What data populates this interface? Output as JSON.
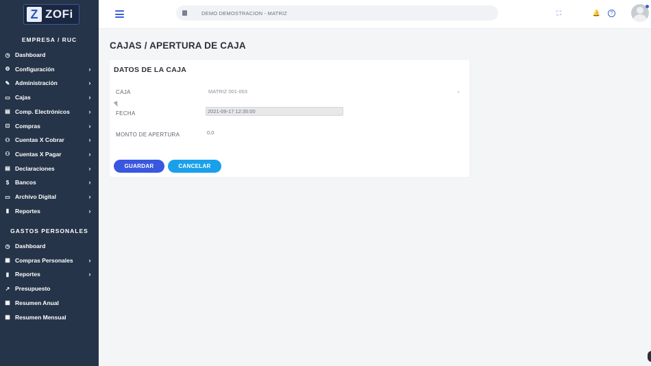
{
  "brand": {
    "logo_letter": "Z",
    "logo_text": "ZOFi"
  },
  "sidebar": {
    "section1_title": "EMPRESA / RUC",
    "items": [
      {
        "label": "Dashboard",
        "icon": "dashboard-icon",
        "glyph": "◷",
        "chevron": ""
      },
      {
        "label": "Configuración",
        "icon": "gear-icon",
        "glyph": "⚙",
        "chevron": "›"
      },
      {
        "label": "Administración",
        "icon": "pencil-icon",
        "glyph": "✎",
        "chevron": "›"
      },
      {
        "label": "Cajas",
        "icon": "cash-box-icon",
        "glyph": "▭",
        "chevron": "›"
      },
      {
        "label": "Comp. Electrónicos",
        "icon": "receipt-icon",
        "glyph": "▤",
        "chevron": "›"
      },
      {
        "label": "Compras",
        "icon": "cart-icon",
        "glyph": "⊡",
        "chevron": "›"
      },
      {
        "label": "Cuentas X Cobrar",
        "icon": "user-receive-icon",
        "glyph": "⚇",
        "chevron": "›"
      },
      {
        "label": "Cuentas X Pagar",
        "icon": "user-pay-icon",
        "glyph": "⚇",
        "chevron": "›"
      },
      {
        "label": "Declaraciones",
        "icon": "document-icon",
        "glyph": "▤",
        "chevron": "›"
      },
      {
        "label": "Bancos",
        "icon": "dollar-icon",
        "glyph": "$",
        "chevron": "›"
      },
      {
        "label": "Archivo Digital",
        "icon": "folder-icon",
        "glyph": "▭",
        "chevron": "›"
      },
      {
        "label": "Reportes",
        "icon": "bar-chart-icon",
        "glyph": "▮",
        "chevron": "›"
      }
    ],
    "section2_title": "GASTOS PERSONALES",
    "items2": [
      {
        "label": "Dashboard",
        "icon": "dashboard-icon",
        "glyph": "◷",
        "chevron": ""
      },
      {
        "label": "Compras Personales",
        "icon": "calendar-icon",
        "glyph": "▦",
        "chevron": "›"
      },
      {
        "label": "Reportes",
        "icon": "bar-chart-icon",
        "glyph": "▮",
        "chevron": "›"
      },
      {
        "label": "Presupuesto",
        "icon": "trend-icon",
        "glyph": "↗",
        "chevron": ""
      },
      {
        "label": "Resumen Anual",
        "icon": "grid-icon",
        "glyph": "▦",
        "chevron": ""
      },
      {
        "label": "Resumen Mensual",
        "icon": "grid-icon",
        "glyph": "▦",
        "chevron": ""
      }
    ]
  },
  "topbar": {
    "branch": "DEMO DEMOSTRACION - MATRIZ",
    "icons": [
      "fullscreen-icon",
      "bell-icon",
      "help-icon"
    ]
  },
  "page": {
    "title": "CAJAS / APERTURA DE CAJA",
    "card_title": "DATOS DE LA CAJA",
    "form": {
      "caja_label": "CAJA",
      "caja_value": "MATRIZ 001-003",
      "fecha_label": "FECHA",
      "fecha_value": "2021-09-17 12:35:00",
      "monto_label": "MONTO DE APERTURA",
      "monto_value": "0,0"
    },
    "buttons": {
      "save": "GUARDAR",
      "cancel": "CANCELAR"
    }
  },
  "colors": {
    "sidebar_bg": "#253449",
    "primary": "#3a57e0",
    "secondary": "#1aa0ea"
  }
}
